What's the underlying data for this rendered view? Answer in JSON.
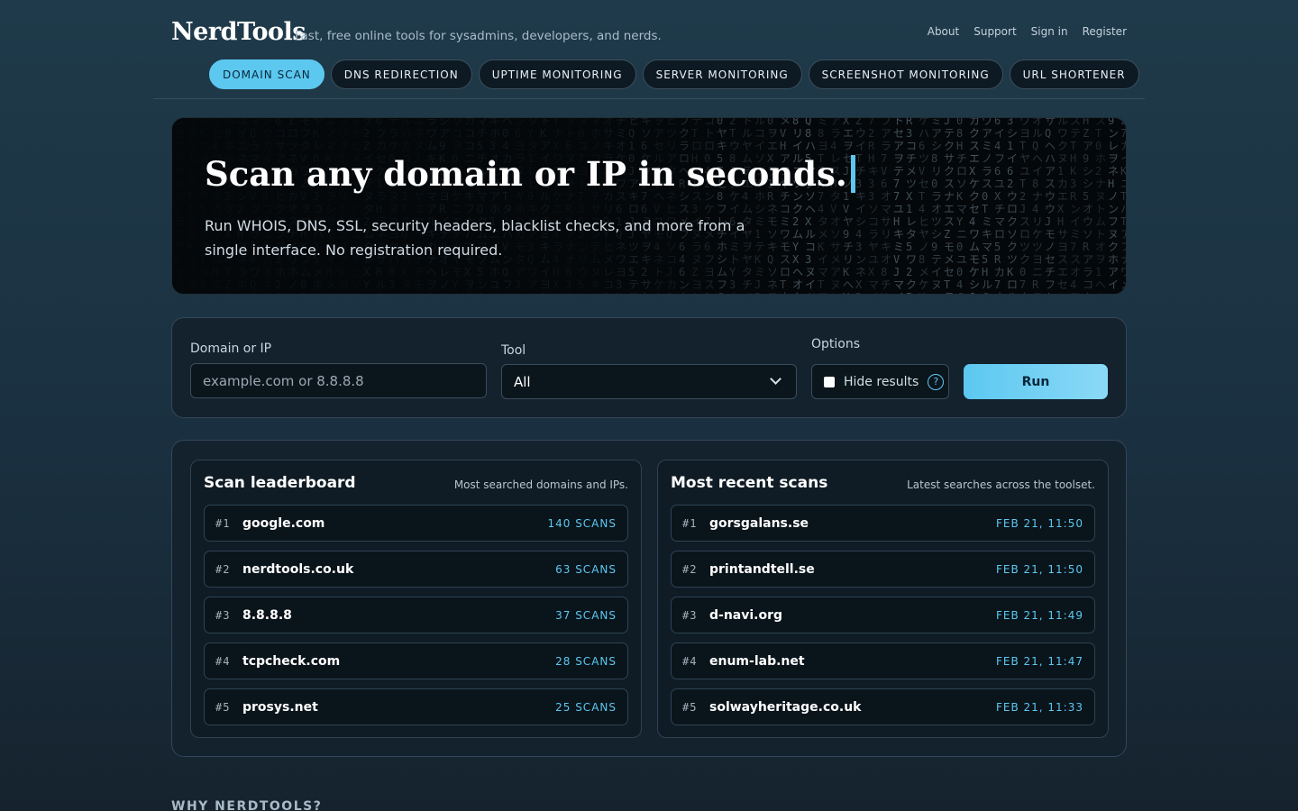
{
  "brand": {
    "logo": "NerdTools",
    "tagline": "Fast, free online tools for sysadmins, developers, and nerds."
  },
  "topnav": [
    "About",
    "Support",
    "Sign in",
    "Register"
  ],
  "tabs": [
    {
      "label": "DOMAIN SCAN",
      "active": true
    },
    {
      "label": "DNS REDIRECTION",
      "active": false
    },
    {
      "label": "UPTIME MONITORING",
      "active": false
    },
    {
      "label": "SERVER MONITORING",
      "active": false
    },
    {
      "label": "SCREENSHOT MONITORING",
      "active": false
    },
    {
      "label": "URL SHORTENER",
      "active": false
    }
  ],
  "hero": {
    "title": "Scan any domain or IP in seconds.",
    "subtitle": "Run WHOIS, DNS, SSL, security headers, blacklist checks, and more from a single interface. No registration required."
  },
  "form": {
    "domain_label": "Domain or IP",
    "domain_placeholder": "example.com or 8.8.8.8",
    "tool_label": "Tool",
    "tool_value": "All",
    "options_label": "Options",
    "hide_results_label": "Hide results",
    "help_glyph": "?",
    "run_label": "Run"
  },
  "leaderboard": {
    "title": "Scan leaderboard",
    "description": "Most searched domains and IPs.",
    "rows": [
      {
        "rank": "#1",
        "domain": "google.com",
        "meta": "140 SCANS"
      },
      {
        "rank": "#2",
        "domain": "nerdtools.co.uk",
        "meta": "63 SCANS"
      },
      {
        "rank": "#3",
        "domain": "8.8.8.8",
        "meta": "37 SCANS"
      },
      {
        "rank": "#4",
        "domain": "tcpcheck.com",
        "meta": "28 SCANS"
      },
      {
        "rank": "#5",
        "domain": "prosys.net",
        "meta": "25 SCANS"
      }
    ]
  },
  "recent": {
    "title": "Most recent scans",
    "description": "Latest searches across the toolset.",
    "rows": [
      {
        "rank": "#1",
        "domain": "gorsgalans.se",
        "meta": "FEB 21, 11:50"
      },
      {
        "rank": "#2",
        "domain": "printandtell.se",
        "meta": "FEB 21, 11:50"
      },
      {
        "rank": "#3",
        "domain": "d-navi.org",
        "meta": "FEB 21, 11:49"
      },
      {
        "rank": "#4",
        "domain": "enum-lab.net",
        "meta": "FEB 21, 11:47"
      },
      {
        "rank": "#5",
        "domain": "solwayheritage.co.uk",
        "meta": "FEB 21, 11:33"
      }
    ]
  },
  "why_heading": "WHY NERDTOOLS?",
  "colors": {
    "accent": "#5cc8f0",
    "background": "#1f3a4a",
    "panel": "#13222d"
  }
}
